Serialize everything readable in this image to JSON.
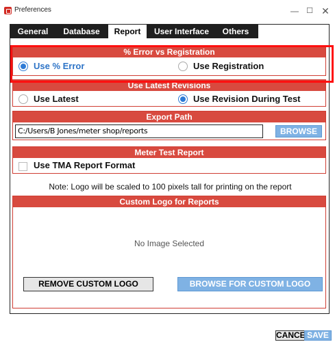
{
  "window": {
    "title": "Preferences",
    "controls": {
      "minimize": "—",
      "maximize": "☐",
      "close": "✕"
    }
  },
  "tabs": [
    {
      "label": "General"
    },
    {
      "label": "Database"
    },
    {
      "label": "Report",
      "active": true
    },
    {
      "label": "User Interface"
    },
    {
      "label": "Others"
    }
  ],
  "error_vs_registration": {
    "header": "% Error vs Registration",
    "options": [
      {
        "label": "Use % Error",
        "checked": true
      },
      {
        "label": "Use Registration",
        "checked": false
      }
    ]
  },
  "latest_revisions": {
    "header": "Use Latest Revisions",
    "options": [
      {
        "label": "Use Latest",
        "checked": false
      },
      {
        "label": "Use Revision During Test",
        "checked": true
      }
    ]
  },
  "export_path": {
    "header": "Export Path",
    "value": "C:/Users/B Jones/meter shop/reports",
    "browse_label": "BROWSE"
  },
  "meter_test_report": {
    "header": "Meter Test Report",
    "checkbox_label": "Use TMA Report Format",
    "checked": false
  },
  "note": "Note: Logo will be scaled to 100 pixels tall for printing on the report",
  "custom_logo": {
    "header": "Custom Logo for Reports",
    "empty_text": "No Image Selected",
    "remove_label": "REMOVE CUSTOM LOGO",
    "browse_label": "BROWSE FOR CUSTOM LOGO"
  },
  "footer": {
    "cancel_label": "CANCEL",
    "save_label": "SAVE"
  },
  "colors": {
    "accent_red": "#d84a3f",
    "highlight_red": "#ff1010",
    "radio_blue": "#2e7bd6",
    "button_blue": "#7fb2e4"
  }
}
